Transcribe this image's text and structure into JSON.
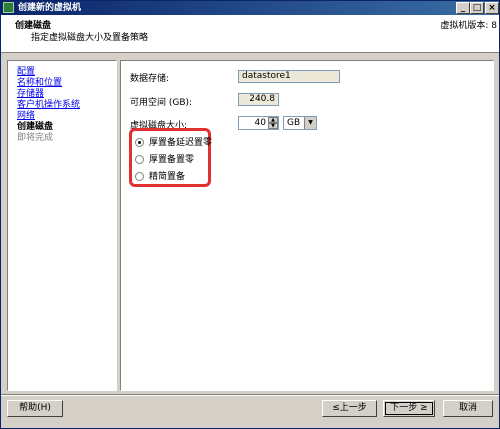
{
  "window": {
    "title": "创建新的虚拟机",
    "minimize_glyph": "_",
    "maximize_glyph": "□",
    "close_glyph": "×"
  },
  "header": {
    "title": "创建磁盘",
    "subtitle": "指定虚拟磁盘大小及置备策略",
    "version": "虚拟机版本: 8"
  },
  "nav": {
    "items": [
      {
        "label": "配置",
        "state": "link"
      },
      {
        "label": "名称和位置",
        "state": "link"
      },
      {
        "label": "存储器",
        "state": "link"
      },
      {
        "label": "客户机操作系统",
        "state": "link"
      },
      {
        "label": "网络",
        "state": "link"
      },
      {
        "label": "创建磁盘",
        "state": "current"
      },
      {
        "label": "即将完成",
        "state": "future"
      }
    ]
  },
  "form": {
    "datastore_label": "数据存储:",
    "datastore_value": "datastore1",
    "free_space_label": "可用空间 (GB):",
    "free_space_value": "240.8",
    "disk_size_label": "虚拟磁盘大小:",
    "disk_size_value": "40",
    "disk_unit": "GB",
    "spin_up": "▲",
    "spin_down": "▼",
    "dropdown_arrow": "▼"
  },
  "provisioning": {
    "options": [
      {
        "label": "厚置备延迟置零",
        "selected": true
      },
      {
        "label": "厚置备置零",
        "selected": false
      },
      {
        "label": "精简置备",
        "selected": false
      }
    ],
    "highlight_color": "#e03030"
  },
  "footer": {
    "help": "帮助(H)",
    "back": "≤上一步",
    "next": "下一步 ≥",
    "cancel": "取消"
  },
  "colors": {
    "titlebar_start": "#0a246a",
    "titlebar_end": "#3a6ea5",
    "link": "#0000ee",
    "dialog_bg": "#d4d0c8"
  }
}
